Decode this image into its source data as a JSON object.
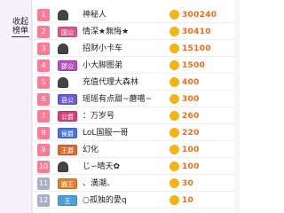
{
  "sidebar": {
    "toggle_line1": "收起",
    "toggle_line2": "榜单"
  },
  "coin_symbol": "⊙",
  "rows": [
    {
      "rank": "1",
      "badge": "",
      "badge_color": "#444444",
      "name": "神秘人",
      "value": "300240"
    },
    {
      "rank": "2",
      "badge": "国公",
      "badge_color": "#d85a8a",
      "name": "情深★無悔★",
      "value": "30410"
    },
    {
      "rank": "3",
      "badge": "",
      "badge_color": "#444444",
      "name": "招财小卡车",
      "value": "15100"
    },
    {
      "rank": "4",
      "badge": "郡公",
      "badge_color": "#b64fc4",
      "name": "小大脚图弟",
      "value": "1500"
    },
    {
      "rank": "5",
      "badge": "",
      "badge_color": "#444444",
      "name": "充值代理大森林",
      "value": "400"
    },
    {
      "rank": "6",
      "badge": "县公",
      "badge_color": "#6c5ccf",
      "name": "瑶瑶有点甜~蘑噶~",
      "value": "300"
    },
    {
      "rank": "7",
      "badge": "公爵",
      "badge_color": "#d6407a",
      "name": "：万岁号",
      "value": "260"
    },
    {
      "rank": "8",
      "badge": "侯爵",
      "badge_color": "#4a76d9",
      "name": "LoL国服一哥",
      "value": "220"
    },
    {
      "rank": "9",
      "badge": "王爵",
      "badge_color": "#e06a2c",
      "name": "幻化",
      "value": "100"
    },
    {
      "rank": "10",
      "badge": "",
      "badge_color": "#444444",
      "name": "じ∽晴天✿",
      "value": "100"
    },
    {
      "rank": "11",
      "badge": "霸王",
      "badge_color": "#e0822c",
      "name": "、満潮、",
      "value": "30"
    },
    {
      "rank": "12",
      "badge": "王",
      "badge_color": "#4aa0d9",
      "name": "○孤独的愛q",
      "value": "10"
    }
  ]
}
